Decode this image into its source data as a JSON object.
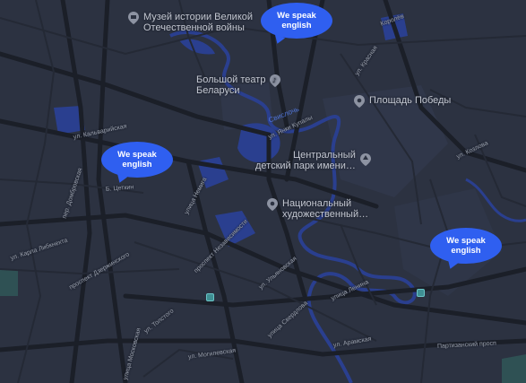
{
  "map": {
    "pois": [
      {
        "id": "museum",
        "label": "Музей истории Великой\nОтечественной войны",
        "icon": "museum-icon"
      },
      {
        "id": "theatre",
        "label": "Большой театр\nБеларуси",
        "icon": "theatre-icon"
      },
      {
        "id": "square",
        "label": "Площадь Победы",
        "icon": "pin-icon"
      },
      {
        "id": "park",
        "label": "Центральный\nдетский парк имени…",
        "icon": "park-icon"
      },
      {
        "id": "artmuseum",
        "label": "Национальный\nхудожественный…",
        "icon": "pin-icon"
      }
    ],
    "river_label": "Свислочь",
    "streets": {
      "kalvariyskaya": "ул. Кальварийская",
      "nemiga": "улица Немига",
      "yanki_kupaly": "ул. Янки Купалы",
      "kozlova": "ул. Козлова",
      "karla_libknehta": "ул. Карла Либкнехта",
      "dzerzhinskogo": "проспект Дзержинского",
      "nezavisimosti": "проспект Независимости",
      "ulyanovskaya": "ул. Ульяновская",
      "lenina": "улица Ленина",
      "sverdlova": "улица Свердлова",
      "tolstogo": "ул. Толстого",
      "mogilevskaya": "ул. Могилевская",
      "moskovskaya": "улица Московская",
      "aramskaya": "ул. Арамская",
      "partizanskiy": "Партизанский просп",
      "krasnaya": "ул. Красная",
      "korolya": "Королёв",
      "dombrovskaya": "пер. Домбровская",
      "b_cetkin": "Б. Цеткин"
    },
    "bubbles": [
      {
        "id": "b1",
        "line1": "We speak",
        "line2": "english"
      },
      {
        "id": "b2",
        "line1": "We speak",
        "line2": "english"
      },
      {
        "id": "b3",
        "line1": "We speak",
        "line2": "english"
      }
    ],
    "colors": {
      "background": "#2c3241",
      "road": "#1c2029",
      "water": "#2a3f8f",
      "bubble": "#2f5ff0",
      "park": "#2f3646"
    }
  }
}
